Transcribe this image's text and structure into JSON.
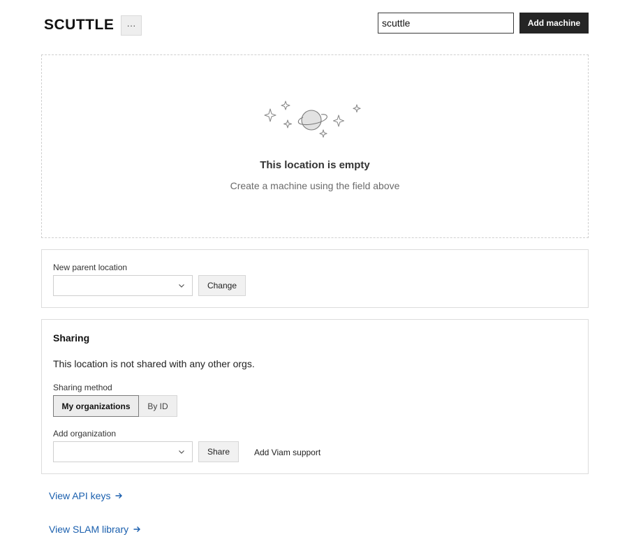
{
  "header": {
    "title": "SCUTTLE",
    "more_label": "···",
    "machine_name_value": "scuttle",
    "add_machine_label": "Add machine"
  },
  "empty_state": {
    "title": "This location is empty",
    "subtitle": "Create a machine using the field above",
    "illustration": "planet-with-sparkles-icon"
  },
  "parent_location": {
    "label": "New parent location",
    "selected": "",
    "change_label": "Change"
  },
  "sharing": {
    "title": "Sharing",
    "status_text": "This location is not shared with any other orgs.",
    "method_label": "Sharing method",
    "methods": [
      {
        "label": "My organizations",
        "active": true
      },
      {
        "label": "By ID",
        "active": false
      }
    ],
    "add_org_label": "Add organization",
    "add_org_selected": "",
    "share_label": "Share",
    "viam_support_label": "Add Viam support"
  },
  "links": {
    "api_keys": "View API keys",
    "slam_library": "View SLAM library"
  },
  "colors": {
    "link": "#1a5fae",
    "primary_button": "#252525"
  }
}
